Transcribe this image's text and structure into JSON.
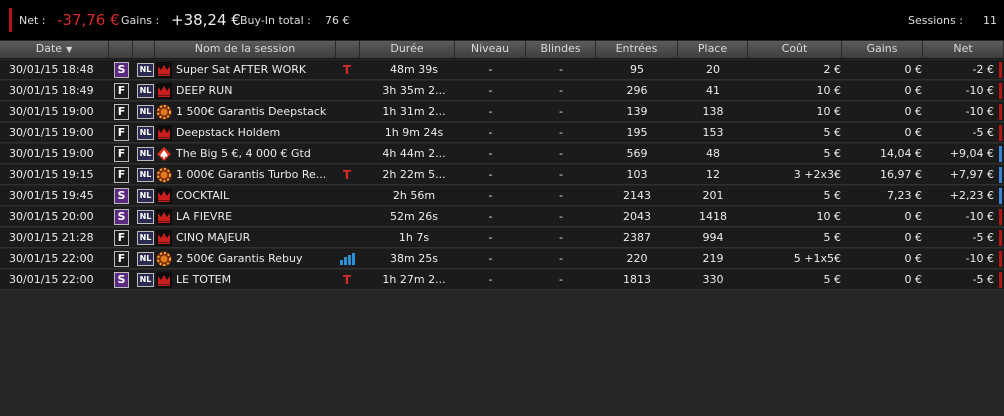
{
  "summary": {
    "net_label": "Net :",
    "net_value": "-37,76 €",
    "gains_label": "Gains :",
    "gains_value": "+38,24 €",
    "buyin_label": "Buy-In total :",
    "buyin_value": "76 €",
    "sessions_label": "Sessions :",
    "sessions_value": "11"
  },
  "columns": {
    "date": "Date",
    "name": "Nom de la session",
    "duree": "Durée",
    "niveau": "Niveau",
    "blindes": "Blindes",
    "entrees": "Entrées",
    "place": "Place",
    "cout": "Coût",
    "gains": "Gains",
    "net": "Net"
  },
  "colors": {
    "negative": "#b31414",
    "positive": "#3a85d6",
    "speed_s": "#5a2a80"
  },
  "rows": [
    {
      "date": "30/01/15 18:48",
      "speed": "S",
      "game": "NL",
      "logo": "crown-logo-icon",
      "name": "Super Sat AFTER WORK",
      "extra": "ticket-icon",
      "duree": "48m 39s",
      "niveau": "-",
      "blindes": "-",
      "entrees": "95",
      "place": "20",
      "cout": "2 €",
      "gains": "0 €",
      "net": "-2 €",
      "sign": "neg"
    },
    {
      "date": "30/01/15 18:49",
      "speed": "F",
      "game": "NL",
      "logo": "crown-logo-icon",
      "name": "DEEP RUN",
      "extra": "",
      "duree": "3h 35m 2...",
      "niveau": "-",
      "blindes": "-",
      "entrees": "296",
      "place": "41",
      "cout": "10 €",
      "gains": "0 €",
      "net": "-10 €",
      "sign": "neg"
    },
    {
      "date": "30/01/15 19:00",
      "speed": "F",
      "game": "NL",
      "logo": "chip-logo-icon",
      "name": "1 500€ Garantis Deepstack",
      "extra": "",
      "duree": "1h 31m 2...",
      "niveau": "-",
      "blindes": "-",
      "entrees": "139",
      "place": "138",
      "cout": "10 €",
      "gains": "0 €",
      "net": "-10 €",
      "sign": "neg"
    },
    {
      "date": "30/01/15 19:00",
      "speed": "F",
      "game": "NL",
      "logo": "crown-logo-icon",
      "name": "Deepstack Holdem",
      "extra": "",
      "duree": "1h 9m 24s",
      "niveau": "-",
      "blindes": "-",
      "entrees": "195",
      "place": "153",
      "cout": "5 €",
      "gains": "0 €",
      "net": "-5 €",
      "sign": "neg"
    },
    {
      "date": "30/01/15 19:00",
      "speed": "F",
      "game": "NL",
      "logo": "spade-logo-icon",
      "name": "The Big 5 €, 4 000 € Gtd",
      "extra": "",
      "duree": "4h 44m 2...",
      "niveau": "-",
      "blindes": "-",
      "entrees": "569",
      "place": "48",
      "cout": "5 €",
      "gains": "14,04 €",
      "net": "+9,04 €",
      "sign": "pos"
    },
    {
      "date": "30/01/15 19:15",
      "speed": "F",
      "game": "NL",
      "logo": "chip-logo-icon",
      "name": "1 000€ Garantis Turbo Re...",
      "extra": "ticket-icon",
      "duree": "2h 22m 5...",
      "niveau": "-",
      "blindes": "-",
      "entrees": "103",
      "place": "12",
      "cout": "3   +2x3€",
      "gains": "16,97 €",
      "net": "+7,97 €",
      "sign": "pos"
    },
    {
      "date": "30/01/15 19:45",
      "speed": "S",
      "game": "NL",
      "logo": "crown-logo-icon",
      "name": "COCKTAIL",
      "extra": "",
      "duree": "2h 56m",
      "niveau": "-",
      "blindes": "-",
      "entrees": "2143",
      "place": "201",
      "cout": "5 €",
      "gains": "7,23 €",
      "net": "+2,23 €",
      "sign": "pos"
    },
    {
      "date": "30/01/15 20:00",
      "speed": "S",
      "game": "NL",
      "logo": "crown-logo-icon",
      "name": "LA FIEVRE",
      "extra": "",
      "duree": "52m 26s",
      "niveau": "-",
      "blindes": "-",
      "entrees": "2043",
      "place": "1418",
      "cout": "10 €",
      "gains": "0 €",
      "net": "-10 €",
      "sign": "neg"
    },
    {
      "date": "30/01/15 21:28",
      "speed": "F",
      "game": "NL",
      "logo": "crown-logo-icon",
      "name": "CINQ MAJEUR",
      "extra": "",
      "duree": "1h 7s",
      "niveau": "-",
      "blindes": "-",
      "entrees": "2387",
      "place": "994",
      "cout": "5 €",
      "gains": "0 €",
      "net": "-5 €",
      "sign": "neg"
    },
    {
      "date": "30/01/15 22:00",
      "speed": "F",
      "game": "NL",
      "logo": "chip-logo-icon",
      "name": "2 500€ Garantis Rebuy",
      "extra": "bars-icon",
      "duree": "38m 25s",
      "niveau": "-",
      "blindes": "-",
      "entrees": "220",
      "place": "219",
      "cout": "5   +1x5€",
      "gains": "0 €",
      "net": "-10 €",
      "sign": "neg"
    },
    {
      "date": "30/01/15 22:00",
      "speed": "S",
      "game": "NL",
      "logo": "crown-logo-icon",
      "name": "LE TOTEM",
      "extra": "ticket-icon",
      "duree": "1h 27m 2...",
      "niveau": "-",
      "blindes": "-",
      "entrees": "1813",
      "place": "330",
      "cout": "5 €",
      "gains": "0 €",
      "net": "-5 €",
      "sign": "neg"
    }
  ]
}
